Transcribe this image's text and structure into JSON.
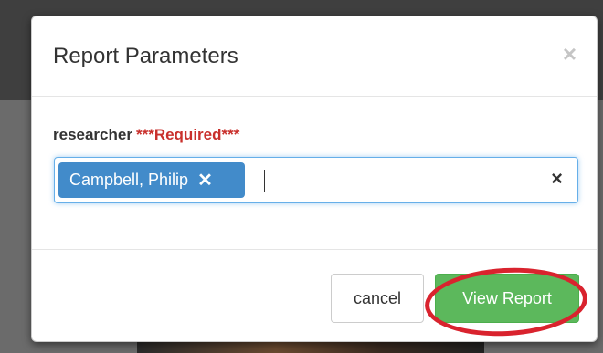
{
  "modal": {
    "title": "Report Parameters",
    "close_glyph": "×"
  },
  "field": {
    "label": "researcher",
    "required_text": "***Required***",
    "selected_tags": [
      {
        "label": "Campbell, Philip",
        "remove_glyph": "✕"
      }
    ],
    "clear_glyph": "×"
  },
  "footer": {
    "cancel_label": "cancel",
    "view_report_label": "View Report"
  },
  "colors": {
    "primary_tag": "#428bca",
    "success_button": "#5cb85c",
    "required_red": "#c9302c",
    "annotation_red": "#d9232e"
  }
}
